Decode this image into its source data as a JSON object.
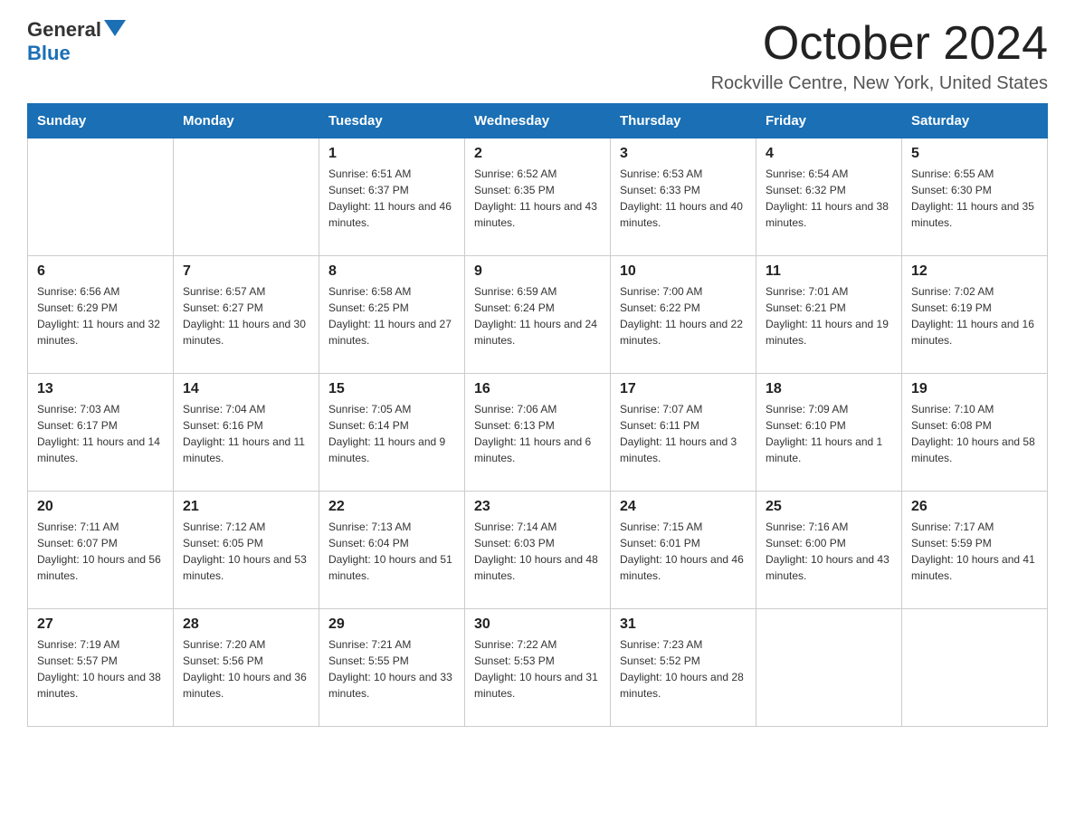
{
  "header": {
    "logo_general": "General",
    "logo_blue": "Blue",
    "month_title": "October 2024",
    "subtitle": "Rockville Centre, New York, United States"
  },
  "days_of_week": [
    "Sunday",
    "Monday",
    "Tuesday",
    "Wednesday",
    "Thursday",
    "Friday",
    "Saturday"
  ],
  "weeks": [
    [
      {
        "day": "",
        "sunrise": "",
        "sunset": "",
        "daylight": ""
      },
      {
        "day": "",
        "sunrise": "",
        "sunset": "",
        "daylight": ""
      },
      {
        "day": "1",
        "sunrise": "Sunrise: 6:51 AM",
        "sunset": "Sunset: 6:37 PM",
        "daylight": "Daylight: 11 hours and 46 minutes."
      },
      {
        "day": "2",
        "sunrise": "Sunrise: 6:52 AM",
        "sunset": "Sunset: 6:35 PM",
        "daylight": "Daylight: 11 hours and 43 minutes."
      },
      {
        "day": "3",
        "sunrise": "Sunrise: 6:53 AM",
        "sunset": "Sunset: 6:33 PM",
        "daylight": "Daylight: 11 hours and 40 minutes."
      },
      {
        "day": "4",
        "sunrise": "Sunrise: 6:54 AM",
        "sunset": "Sunset: 6:32 PM",
        "daylight": "Daylight: 11 hours and 38 minutes."
      },
      {
        "day": "5",
        "sunrise": "Sunrise: 6:55 AM",
        "sunset": "Sunset: 6:30 PM",
        "daylight": "Daylight: 11 hours and 35 minutes."
      }
    ],
    [
      {
        "day": "6",
        "sunrise": "Sunrise: 6:56 AM",
        "sunset": "Sunset: 6:29 PM",
        "daylight": "Daylight: 11 hours and 32 minutes."
      },
      {
        "day": "7",
        "sunrise": "Sunrise: 6:57 AM",
        "sunset": "Sunset: 6:27 PM",
        "daylight": "Daylight: 11 hours and 30 minutes."
      },
      {
        "day": "8",
        "sunrise": "Sunrise: 6:58 AM",
        "sunset": "Sunset: 6:25 PM",
        "daylight": "Daylight: 11 hours and 27 minutes."
      },
      {
        "day": "9",
        "sunrise": "Sunrise: 6:59 AM",
        "sunset": "Sunset: 6:24 PM",
        "daylight": "Daylight: 11 hours and 24 minutes."
      },
      {
        "day": "10",
        "sunrise": "Sunrise: 7:00 AM",
        "sunset": "Sunset: 6:22 PM",
        "daylight": "Daylight: 11 hours and 22 minutes."
      },
      {
        "day": "11",
        "sunrise": "Sunrise: 7:01 AM",
        "sunset": "Sunset: 6:21 PM",
        "daylight": "Daylight: 11 hours and 19 minutes."
      },
      {
        "day": "12",
        "sunrise": "Sunrise: 7:02 AM",
        "sunset": "Sunset: 6:19 PM",
        "daylight": "Daylight: 11 hours and 16 minutes."
      }
    ],
    [
      {
        "day": "13",
        "sunrise": "Sunrise: 7:03 AM",
        "sunset": "Sunset: 6:17 PM",
        "daylight": "Daylight: 11 hours and 14 minutes."
      },
      {
        "day": "14",
        "sunrise": "Sunrise: 7:04 AM",
        "sunset": "Sunset: 6:16 PM",
        "daylight": "Daylight: 11 hours and 11 minutes."
      },
      {
        "day": "15",
        "sunrise": "Sunrise: 7:05 AM",
        "sunset": "Sunset: 6:14 PM",
        "daylight": "Daylight: 11 hours and 9 minutes."
      },
      {
        "day": "16",
        "sunrise": "Sunrise: 7:06 AM",
        "sunset": "Sunset: 6:13 PM",
        "daylight": "Daylight: 11 hours and 6 minutes."
      },
      {
        "day": "17",
        "sunrise": "Sunrise: 7:07 AM",
        "sunset": "Sunset: 6:11 PM",
        "daylight": "Daylight: 11 hours and 3 minutes."
      },
      {
        "day": "18",
        "sunrise": "Sunrise: 7:09 AM",
        "sunset": "Sunset: 6:10 PM",
        "daylight": "Daylight: 11 hours and 1 minute."
      },
      {
        "day": "19",
        "sunrise": "Sunrise: 7:10 AM",
        "sunset": "Sunset: 6:08 PM",
        "daylight": "Daylight: 10 hours and 58 minutes."
      }
    ],
    [
      {
        "day": "20",
        "sunrise": "Sunrise: 7:11 AM",
        "sunset": "Sunset: 6:07 PM",
        "daylight": "Daylight: 10 hours and 56 minutes."
      },
      {
        "day": "21",
        "sunrise": "Sunrise: 7:12 AM",
        "sunset": "Sunset: 6:05 PM",
        "daylight": "Daylight: 10 hours and 53 minutes."
      },
      {
        "day": "22",
        "sunrise": "Sunrise: 7:13 AM",
        "sunset": "Sunset: 6:04 PM",
        "daylight": "Daylight: 10 hours and 51 minutes."
      },
      {
        "day": "23",
        "sunrise": "Sunrise: 7:14 AM",
        "sunset": "Sunset: 6:03 PM",
        "daylight": "Daylight: 10 hours and 48 minutes."
      },
      {
        "day": "24",
        "sunrise": "Sunrise: 7:15 AM",
        "sunset": "Sunset: 6:01 PM",
        "daylight": "Daylight: 10 hours and 46 minutes."
      },
      {
        "day": "25",
        "sunrise": "Sunrise: 7:16 AM",
        "sunset": "Sunset: 6:00 PM",
        "daylight": "Daylight: 10 hours and 43 minutes."
      },
      {
        "day": "26",
        "sunrise": "Sunrise: 7:17 AM",
        "sunset": "Sunset: 5:59 PM",
        "daylight": "Daylight: 10 hours and 41 minutes."
      }
    ],
    [
      {
        "day": "27",
        "sunrise": "Sunrise: 7:19 AM",
        "sunset": "Sunset: 5:57 PM",
        "daylight": "Daylight: 10 hours and 38 minutes."
      },
      {
        "day": "28",
        "sunrise": "Sunrise: 7:20 AM",
        "sunset": "Sunset: 5:56 PM",
        "daylight": "Daylight: 10 hours and 36 minutes."
      },
      {
        "day": "29",
        "sunrise": "Sunrise: 7:21 AM",
        "sunset": "Sunset: 5:55 PM",
        "daylight": "Daylight: 10 hours and 33 minutes."
      },
      {
        "day": "30",
        "sunrise": "Sunrise: 7:22 AM",
        "sunset": "Sunset: 5:53 PM",
        "daylight": "Daylight: 10 hours and 31 minutes."
      },
      {
        "day": "31",
        "sunrise": "Sunrise: 7:23 AM",
        "sunset": "Sunset: 5:52 PM",
        "daylight": "Daylight: 10 hours and 28 minutes."
      },
      {
        "day": "",
        "sunrise": "",
        "sunset": "",
        "daylight": ""
      },
      {
        "day": "",
        "sunrise": "",
        "sunset": "",
        "daylight": ""
      }
    ]
  ]
}
